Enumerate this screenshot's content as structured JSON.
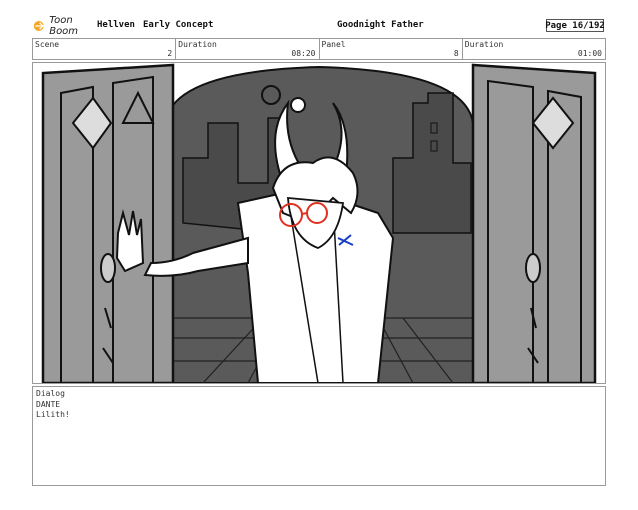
{
  "header": {
    "logo_text": "Toon Boom",
    "project_name": "Hellven",
    "project_subtitle": "Early Concept",
    "episode_title": "Goodnight Father",
    "page_label": "Page",
    "page_value": "16/192"
  },
  "info": {
    "scene_label": "Scene",
    "scene_value": "2",
    "scene_duration_label": "Duration",
    "scene_duration_value": "08:20",
    "panel_label": "Panel",
    "panel_value": "8",
    "panel_duration_label": "Duration",
    "panel_duration_value": "01:00"
  },
  "dialog": {
    "label": "Dialog",
    "character": "DANTE",
    "line": "Lilith!"
  },
  "colors": {
    "logo_accent": "#f5a623",
    "glasses": "#e03020",
    "mark": "#1a3cc8"
  }
}
